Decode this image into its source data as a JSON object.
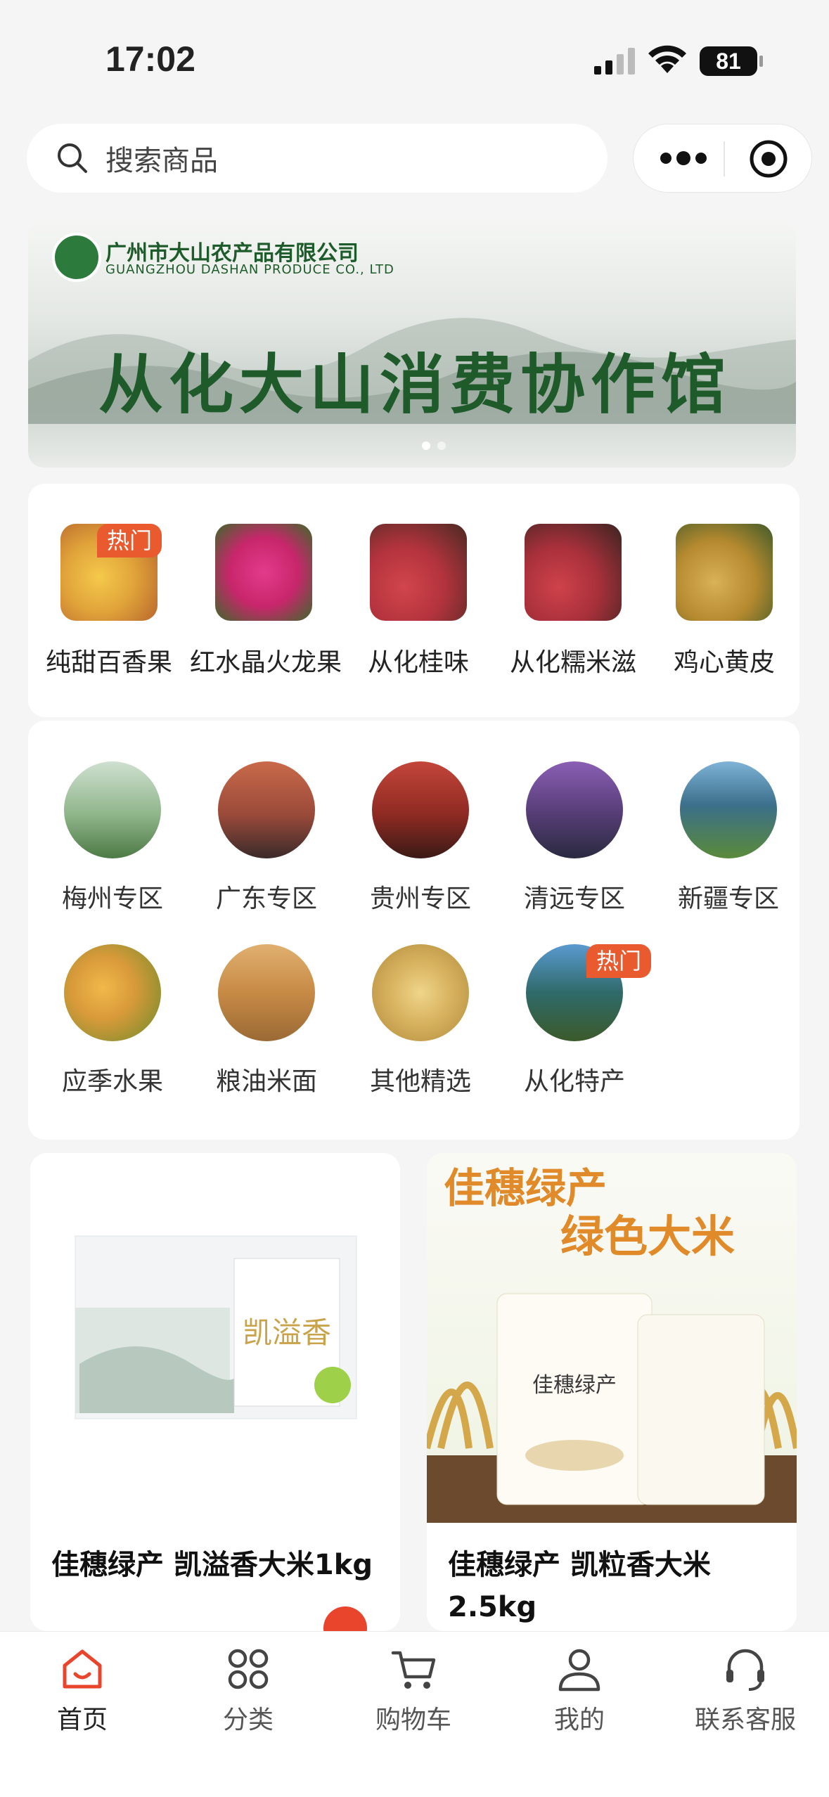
{
  "status_bar": {
    "time": "17:02",
    "battery": "81"
  },
  "search": {
    "placeholder": "搜索商品"
  },
  "banner": {
    "company_cn": "广州市大山农产品有限公司",
    "company_en": "GUANGZHOU DASHAN PRODUCE CO., LTD",
    "slogan": "从化大山消费协作馆"
  },
  "hot_items": [
    {
      "label": "纯甜百香果",
      "badge": "热门",
      "color": "#e8b24a"
    },
    {
      "label": "红水晶火龙果",
      "color": "#c8266b"
    },
    {
      "label": "从化桂味",
      "tag": "桂味荔枝",
      "color": "#b3333d"
    },
    {
      "label": "从化糯米滋",
      "tag": "糯米糍荔枝",
      "color": "#a8303b"
    },
    {
      "label": "鸡心黄皮",
      "color": "#b5892f"
    }
  ],
  "zones": [
    {
      "label": "梅州专区",
      "color": "#8fb58a"
    },
    {
      "label": "广东专区",
      "color": "#9a4a3a"
    },
    {
      "label": "贵州专区",
      "color": "#8e2a22"
    },
    {
      "label": "清远专区",
      "color": "#5a3f7a"
    },
    {
      "label": "新疆专区",
      "color": "#3b6f8a"
    },
    {
      "label": "应季水果",
      "color": "#d89a3a"
    },
    {
      "label": "粮油米面",
      "color": "#c78a45"
    },
    {
      "label": "其他精选",
      "color": "#d7b25f"
    },
    {
      "label": "从化特产",
      "badge": "热门",
      "color": "#2f6a6a"
    }
  ],
  "products": [
    {
      "name": "佳穗绿产 凯溢香大米1kg",
      "box_text": "凯溢香"
    },
    {
      "name": "佳穗绿产 凯粒香大米2.5kg",
      "headline1": "佳穗绿产",
      "headline2": "绿色大米",
      "bag_text": "佳穗绿产"
    }
  ],
  "tabbar": [
    {
      "label": "首页",
      "icon": "home-icon",
      "active": true
    },
    {
      "label": "分类",
      "icon": "category-icon"
    },
    {
      "label": "购物车",
      "icon": "cart-icon"
    },
    {
      "label": "我的",
      "icon": "user-icon"
    },
    {
      "label": "联系客服",
      "icon": "headset-icon"
    }
  ],
  "colors": {
    "accent": "#e95a2f",
    "brand_green": "#1f5a2a"
  }
}
